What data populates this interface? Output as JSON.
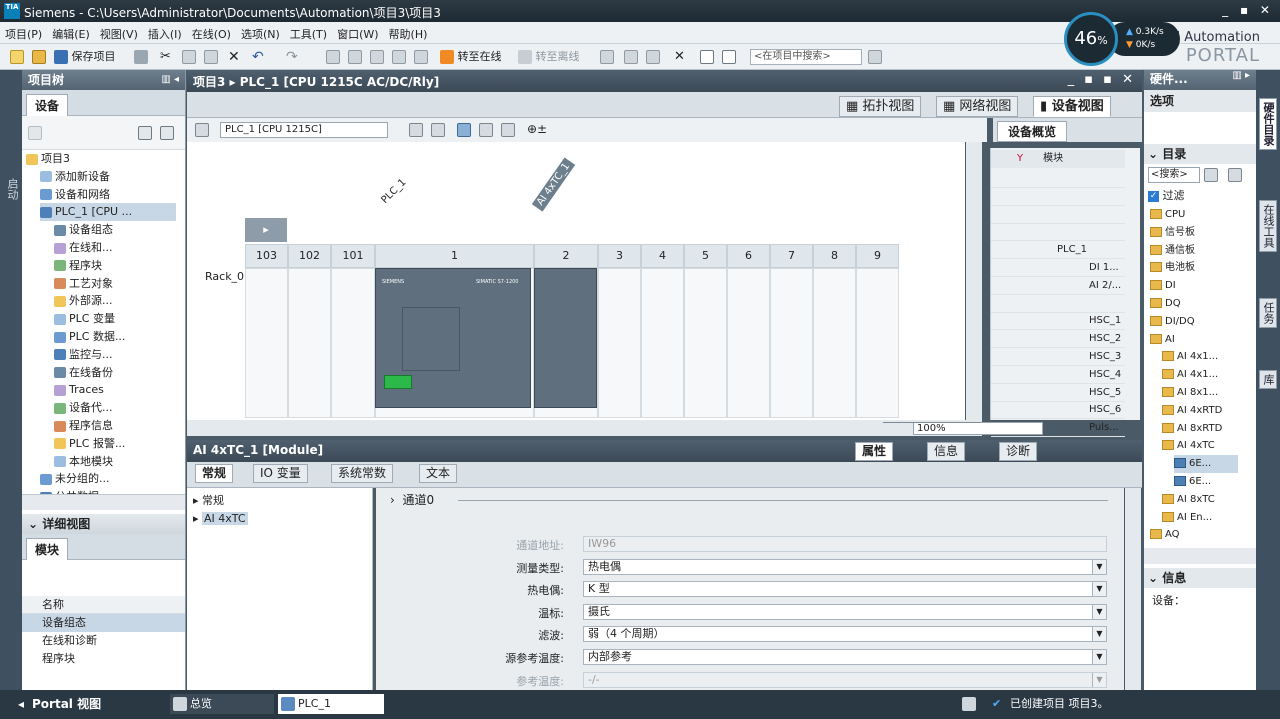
{
  "window": {
    "app": "Siemens",
    "title": "Siemens  -  C:\\Users\\Administrator\\Documents\\Automation\\项目3\\项目3",
    "controls": "_ ▪ ✕"
  },
  "menu": [
    "项目(P)",
    "编辑(E)",
    "视图(V)",
    "插入(I)",
    "在线(O)",
    "选项(N)",
    "工具(T)",
    "窗口(W)",
    "帮助(H)"
  ],
  "toolbar": {
    "save": "保存项目",
    "go_online": "转至在线",
    "go_offline": "转至离线",
    "search_placeholder": "<在项目中搜索>"
  },
  "portal": {
    "line1": "Totally Integrated Automation",
    "line2": "PORTAL"
  },
  "net_gauge": {
    "percent": "46",
    "unit": "%",
    "up": "0.3K/s",
    "down": "0K/s"
  },
  "side_left": {
    "tab": "启动"
  },
  "project_tree": {
    "title": "项目树",
    "tab": "设备",
    "items": [
      {
        "label": "项目3",
        "level": 0
      },
      {
        "label": "添加新设备",
        "level": 1
      },
      {
        "label": "设备和网络",
        "level": 1
      },
      {
        "label": "PLC_1 [CPU ...",
        "level": 1,
        "selected": true
      },
      {
        "label": "设备组态",
        "level": 2
      },
      {
        "label": "在线和...",
        "level": 2
      },
      {
        "label": "程序块",
        "level": 2
      },
      {
        "label": "工艺对象",
        "level": 2
      },
      {
        "label": "外部源...",
        "level": 2
      },
      {
        "label": "PLC 变量",
        "level": 2
      },
      {
        "label": "PLC 数据...",
        "level": 2
      },
      {
        "label": "监控与...",
        "level": 2
      },
      {
        "label": "在线备份",
        "level": 2
      },
      {
        "label": "Traces",
        "level": 2
      },
      {
        "label": "设备代...",
        "level": 2
      },
      {
        "label": "程序信息",
        "level": 2
      },
      {
        "label": "PLC 报警...",
        "level": 2
      },
      {
        "label": "本地模块",
        "level": 2
      },
      {
        "label": "未分组的...",
        "level": 1
      },
      {
        "label": "公共数据",
        "level": 1
      }
    ]
  },
  "detail_view": {
    "title": "详细视图",
    "tab": "模块",
    "col_name": "名称",
    "items": [
      "设备组态",
      "在线和诊断",
      "程序块"
    ]
  },
  "editor": {
    "breadcrumb": "项目3 ▸ PLC_1 [CPU 1215C AC/DC/Rly]",
    "controls": "_ ▪ ▪ ✕",
    "view_tabs": [
      "拓扑视图",
      "网络视图",
      "设备视图"
    ],
    "device_select": "PLC_1 [CPU 1215C]",
    "label_plc": "PLC_1",
    "label_module": "AI 4xTC_1",
    "rack": "Rack_0",
    "slots": [
      "103",
      "102",
      "101",
      "1",
      "2",
      "3",
      "4",
      "5",
      "6",
      "7",
      "8",
      "9"
    ],
    "cpu_brand": "SIEMENS",
    "cpu_model": "SIMATIC S7-1200",
    "zoom": "100%"
  },
  "overview": {
    "title": "设备概览",
    "col_module": "模块",
    "rows": [
      "",
      "",
      "",
      "",
      "PLC_1",
      "DI 1...",
      "AI 2/...",
      "",
      "HSC_1",
      "HSC_2",
      "HSC_3",
      "HSC_4",
      "HSC_5",
      "HSC_6",
      "Puls..."
    ]
  },
  "properties": {
    "title": "AI 4xTC_1 [Module]",
    "right_tabs": [
      "属性",
      "信息",
      "诊断"
    ],
    "tabs": [
      "常规",
      "IO 变量",
      "系统常数",
      "文本"
    ],
    "nav": [
      "常规",
      "AI 4xTC"
    ],
    "section": "通道0",
    "fields": [
      {
        "label": "通道地址:",
        "value": "IW96",
        "disabled": true
      },
      {
        "label": "测量类型:",
        "value": "热电偶"
      },
      {
        "label": "热电偶:",
        "value": "K 型"
      },
      {
        "label": "温标:",
        "value": "摄氏"
      },
      {
        "label": "滤波:",
        "value": "弱（4 个周期）"
      },
      {
        "label": "源参考温度:",
        "value": "内部参考"
      },
      {
        "label": "参考温度:",
        "value": "-/-",
        "disabled": true
      }
    ]
  },
  "catalog": {
    "title": "硬件...",
    "options": "选项",
    "catalog": "目录",
    "search_placeholder": "<搜索>",
    "filter": "过滤",
    "items": [
      {
        "label": "CPU",
        "level": 0
      },
      {
        "label": "信号板",
        "level": 0
      },
      {
        "label": "通信板",
        "level": 0
      },
      {
        "label": "电池板",
        "level": 0
      },
      {
        "label": "DI",
        "level": 0
      },
      {
        "label": "DQ",
        "level": 0
      },
      {
        "label": "DI/DQ",
        "level": 0
      },
      {
        "label": "AI",
        "level": 0
      },
      {
        "label": "AI 4x1...",
        "level": 1
      },
      {
        "label": "AI 4x1...",
        "level": 1
      },
      {
        "label": "AI 8x1...",
        "level": 1
      },
      {
        "label": "AI 4xRTD",
        "level": 1
      },
      {
        "label": "AI 8xRTD",
        "level": 1
      },
      {
        "label": "AI 4xTC",
        "level": 1
      },
      {
        "label": "6E...",
        "level": 2,
        "selected": true
      },
      {
        "label": "6E...",
        "level": 2
      },
      {
        "label": "AI 8xTC",
        "level": 1
      },
      {
        "label": "AI En...",
        "level": 1
      },
      {
        "label": "AQ",
        "level": 0
      }
    ],
    "info_title": "信息",
    "device_label": "设备："
  },
  "side_right_tabs": [
    "硬件目录",
    "在线工具",
    "任务",
    "库"
  ],
  "statusbar": {
    "portal_view": "Portal 视图",
    "overview_tab": "总览",
    "plc_tab": "PLC_1",
    "message": "已创建项目 项目3。"
  }
}
